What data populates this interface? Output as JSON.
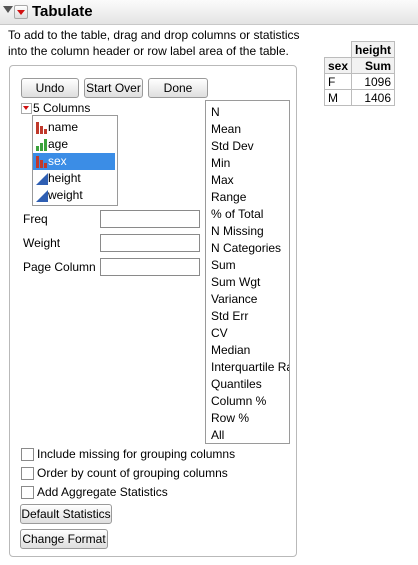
{
  "window": {
    "title": "Tabulate"
  },
  "instructions": {
    "line1": "To add to the table, drag and drop columns or statistics",
    "line2": "into the column header or row label area of the table."
  },
  "toolbar": {
    "undo_label": "Undo",
    "start_over_label": "Start Over",
    "done_label": "Done"
  },
  "columns": {
    "count_label": "5 Columns",
    "items": [
      {
        "name": "name",
        "icon": "nominal-bar-icon",
        "selected": false
      },
      {
        "name": "age",
        "icon": "ordinal-bar-icon",
        "selected": false
      },
      {
        "name": "sex",
        "icon": "nominal-bar-icon",
        "selected": true
      },
      {
        "name": "height",
        "icon": "continuous-triangle-icon",
        "selected": false
      },
      {
        "name": "weight",
        "icon": "continuous-triangle-icon",
        "selected": false
      }
    ]
  },
  "roles": {
    "freq": "Freq",
    "weight": "Weight",
    "page_column": "Page Column"
  },
  "statistics": [
    "N",
    "Mean",
    "Std Dev",
    "Min",
    "Max",
    "Range",
    "% of Total",
    "N Missing",
    "N Categories",
    "Sum",
    "Sum Wgt",
    "Variance",
    "Std Err",
    "CV",
    "Median",
    "Interquartile Range",
    "Quantiles",
    "Column %",
    "Row %",
    "All"
  ],
  "options": {
    "include_missing": "Include missing for grouping columns",
    "order_by_count": "Order by count of grouping columns",
    "add_aggregate": "Add Aggregate Statistics"
  },
  "buttons": {
    "default_statistics": "Default Statistics",
    "change_format": "Change Format"
  },
  "result_table": {
    "col_header": "height",
    "stat_header": "Sum",
    "row_header": "sex",
    "rows": [
      {
        "label": "F",
        "value": "1096"
      },
      {
        "label": "M",
        "value": "1406"
      }
    ]
  },
  "colors": {
    "selection": "#3b8de6",
    "nominal_red": "#c0392b",
    "ordinal_green": "#3aa23a",
    "continuous_blue": "#2f5fb3",
    "menu_red": "#d01010"
  }
}
